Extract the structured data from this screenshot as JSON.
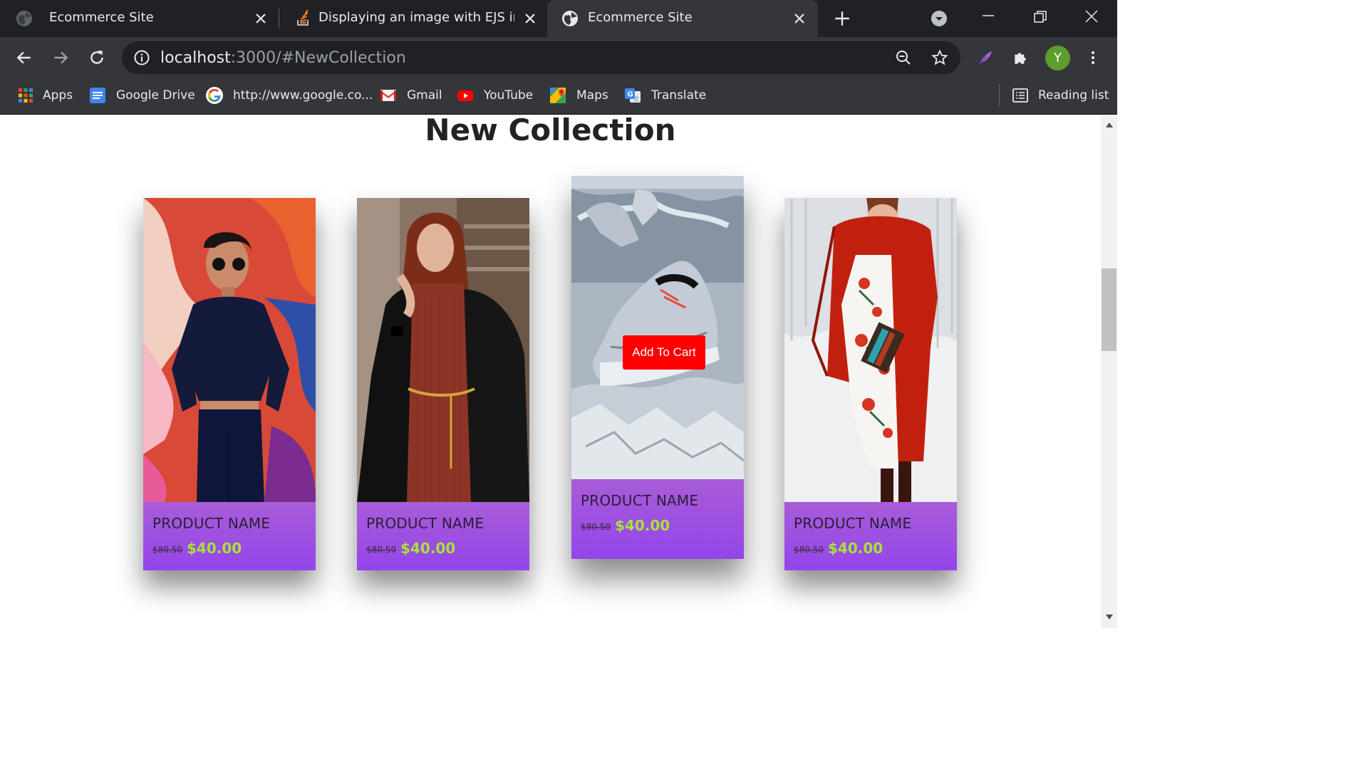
{
  "browser": {
    "tabs": [
      {
        "title": "Ecommerce Site",
        "icon": "globe-icon",
        "active": false
      },
      {
        "title": "Displaying an image with EJS in nod",
        "icon": "stackoverflow-icon",
        "active": false
      },
      {
        "title": "Ecommerce Site",
        "icon": "globe-icon",
        "active": true
      }
    ],
    "url_host": "localhost",
    "url_rest": ":3000/#NewCollection",
    "profile_initial": "Y",
    "bookmarks": [
      {
        "label": "Apps",
        "icon": "apps-grid-icon"
      },
      {
        "label": "Google Drive",
        "icon": "google-docs-icon"
      },
      {
        "label": "http://www.google.co...",
        "icon": "google-icon"
      },
      {
        "label": "Gmail",
        "icon": "gmail-icon"
      },
      {
        "label": "YouTube",
        "icon": "youtube-icon"
      },
      {
        "label": "Maps",
        "icon": "maps-icon"
      },
      {
        "label": "Translate",
        "icon": "translate-icon"
      }
    ],
    "reading_list": "Reading list"
  },
  "page": {
    "title": "New Collection",
    "add_to_cart": "Add To Cart",
    "products": [
      {
        "name": "PRODUCT NAME",
        "old_price": "$80.50",
        "price": "$40.00",
        "image": "woman in navy outfit and sunglasses against graffiti wall"
      },
      {
        "name": "PRODUCT NAME",
        "old_price": "$80.50",
        "price": "$40.00",
        "image": "woman in rust knit dress and black coat"
      },
      {
        "name": "PRODUCT NAME",
        "old_price": "$80.50",
        "price": "$40.00",
        "image": "silver sneaker on foil"
      },
      {
        "name": "PRODUCT NAME",
        "old_price": "$80.50",
        "price": "$40.00",
        "image": "woman in red coat and floral dress in snow"
      }
    ]
  },
  "colors": {
    "card_bottom": "#9445ea",
    "price_green": "#a7e23a",
    "cart_button": "#ff0000"
  }
}
